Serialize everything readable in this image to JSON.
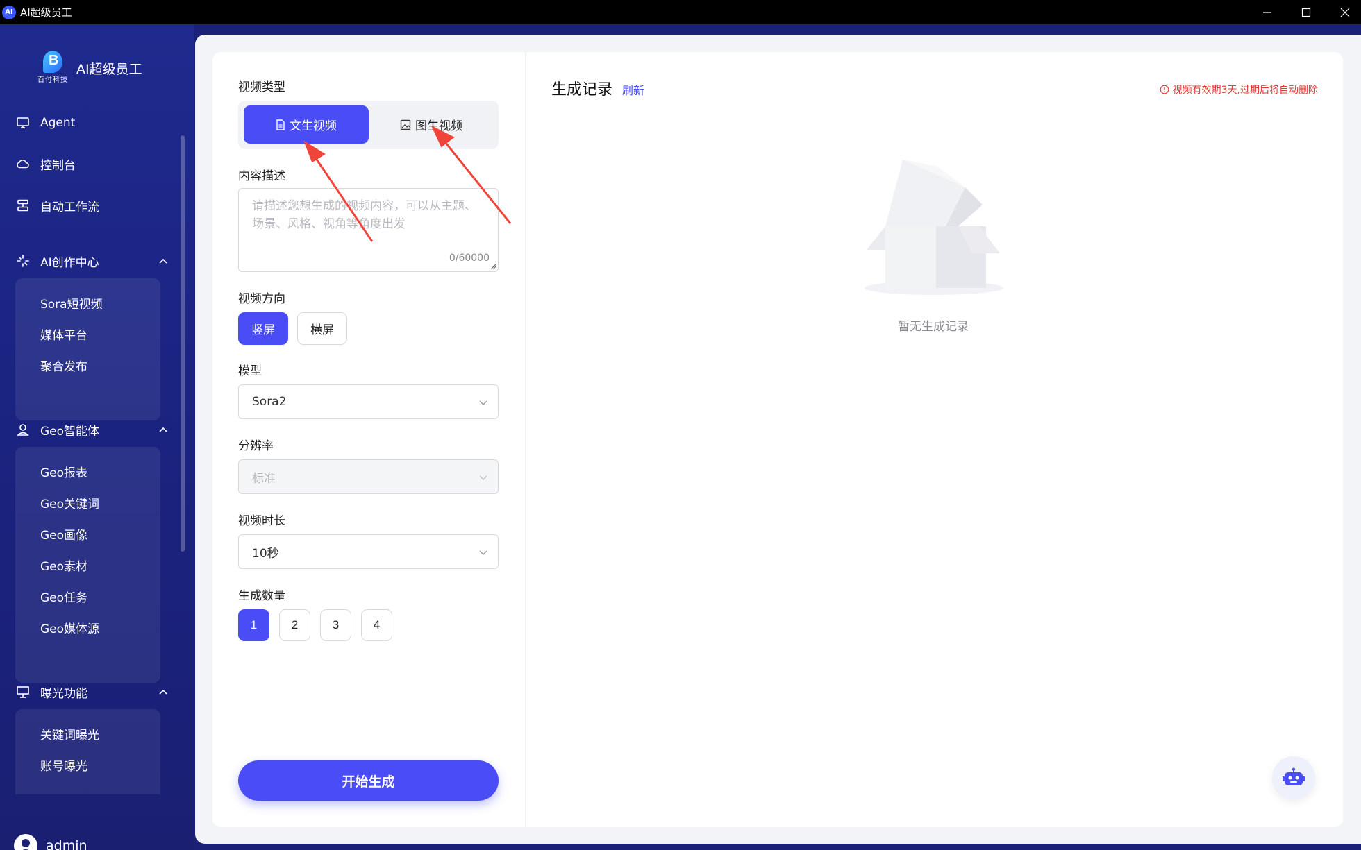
{
  "window": {
    "title": "AI超级员工",
    "app_icon": "AI"
  },
  "sidebar": {
    "brand": {
      "logo_text": "百付科技",
      "name": "AI超级员工"
    },
    "items": [
      {
        "label": "Agent",
        "icon": "monitor-icon"
      },
      {
        "label": "控制台",
        "icon": "cloud-icon"
      },
      {
        "label": "自动工作流",
        "icon": "workflow-icon"
      }
    ],
    "groups": [
      {
        "label": "AI创作中心",
        "icon": "sparkle-icon",
        "children": [
          "Sora短视频",
          "媒体平台",
          "聚合发布"
        ]
      },
      {
        "label": "Geo智能体",
        "icon": "user-pin-icon",
        "children": [
          "Geo报表",
          "Geo关键词",
          "Geo画像",
          "Geo素材",
          "Geo任务",
          "Geo媒体源"
        ]
      },
      {
        "label": "曝光功能",
        "icon": "presentation-icon",
        "children": [
          "关键词曝光",
          "账号曝光"
        ]
      }
    ],
    "user": {
      "name": "admin"
    }
  },
  "form": {
    "video_type": {
      "label": "视频类型",
      "options": [
        "文生视频",
        "图生视频"
      ],
      "selected": "文生视频"
    },
    "content": {
      "label": "内容描述",
      "placeholder": "请描述您想生成的视频内容，可以从主题、场景、风格、视角等角度出发",
      "counter": "0/60000"
    },
    "orientation": {
      "label": "视频方向",
      "options": [
        "竖屏",
        "横屏"
      ],
      "selected": "竖屏"
    },
    "model": {
      "label": "模型",
      "value": "Sora2"
    },
    "resolution": {
      "label": "分辨率",
      "value": "标准",
      "disabled": true
    },
    "duration": {
      "label": "视频时长",
      "value": "10秒"
    },
    "quantity": {
      "label": "生成数量",
      "options": [
        "1",
        "2",
        "3",
        "4"
      ],
      "selected": "1"
    },
    "submit_label": "开始生成"
  },
  "records": {
    "title": "生成记录",
    "refresh_label": "刷新",
    "notice": "视频有效期3天,过期后将自动删除",
    "empty_text": "暂无生成记录"
  },
  "colors": {
    "accent": "#4a4cf5",
    "sidebar_bg": "#1c2178",
    "notice": "#e53935",
    "annotation_arrow": "#f0443a"
  }
}
